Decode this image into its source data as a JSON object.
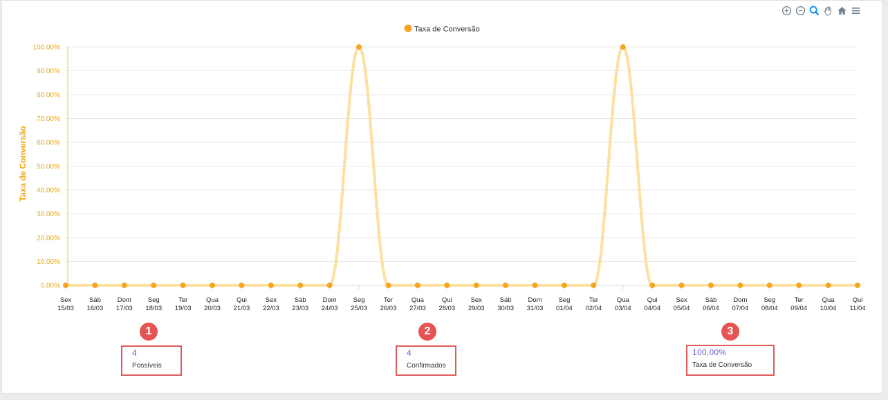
{
  "toolbar": {
    "icons": [
      "zoom-in-icon",
      "zoom-out-icon",
      "selection-zoom-icon",
      "pan-icon",
      "home-icon",
      "menu-icon"
    ]
  },
  "colors": {
    "series": "#f5a623",
    "line": "#fddfa0",
    "axis_text": "#f0a800",
    "badge": "#e65353",
    "stat_border": "#e05a5a",
    "stat_value": "#6b5bd6"
  },
  "chart_data": {
    "type": "line",
    "legend": [
      "Taxa de Conversão"
    ],
    "legend_position": "top-center",
    "ylabel": "Taxa de Conversão",
    "ylim": [
      0,
      100
    ],
    "yticks": [
      "0.00%",
      "10.00%",
      "20.00%",
      "30.00%",
      "40.00%",
      "50.00%",
      "60.00%",
      "70.00%",
      "80.00%",
      "90.00%",
      "100.00%"
    ],
    "grid": true,
    "categories": [
      [
        "Sex",
        "15/03"
      ],
      [
        "Sáb",
        "16/03"
      ],
      [
        "Dom",
        "17/03"
      ],
      [
        "Seg",
        "18/03"
      ],
      [
        "Ter",
        "19/03"
      ],
      [
        "Qua",
        "20/03"
      ],
      [
        "Qui",
        "21/03"
      ],
      [
        "Sex",
        "22/03"
      ],
      [
        "Sáb",
        "23/03"
      ],
      [
        "Dom",
        "24/03"
      ],
      [
        "Seg",
        "25/03"
      ],
      [
        "Ter",
        "26/03"
      ],
      [
        "Qua",
        "27/03"
      ],
      [
        "Qui",
        "28/03"
      ],
      [
        "Sex",
        "29/03"
      ],
      [
        "Sáb",
        "30/03"
      ],
      [
        "Dom",
        "31/03"
      ],
      [
        "Seg",
        "01/04"
      ],
      [
        "Ter",
        "02/04"
      ],
      [
        "Qua",
        "03/04"
      ],
      [
        "Qui",
        "04/04"
      ],
      [
        "Sex",
        "05/04"
      ],
      [
        "Sáb",
        "06/04"
      ],
      [
        "Dom",
        "07/04"
      ],
      [
        "Seg",
        "08/04"
      ],
      [
        "Ter",
        "09/04"
      ],
      [
        "Qua",
        "10/04"
      ],
      [
        "Qui",
        "11/04"
      ]
    ],
    "series": [
      {
        "name": "Taxa de Conversão",
        "values": [
          0,
          0,
          0,
          0,
          0,
          0,
          0,
          0,
          0,
          0,
          100,
          0,
          0,
          0,
          0,
          0,
          0,
          0,
          0,
          100,
          0,
          0,
          0,
          0,
          0,
          0,
          0,
          0
        ]
      }
    ]
  },
  "stats": [
    {
      "badge": "1",
      "value": "4",
      "label": "Possíveis"
    },
    {
      "badge": "2",
      "value": "4",
      "label": "Confirmados"
    },
    {
      "badge": "3",
      "value": "100,00%",
      "label": "Taxa de Conversão"
    }
  ]
}
